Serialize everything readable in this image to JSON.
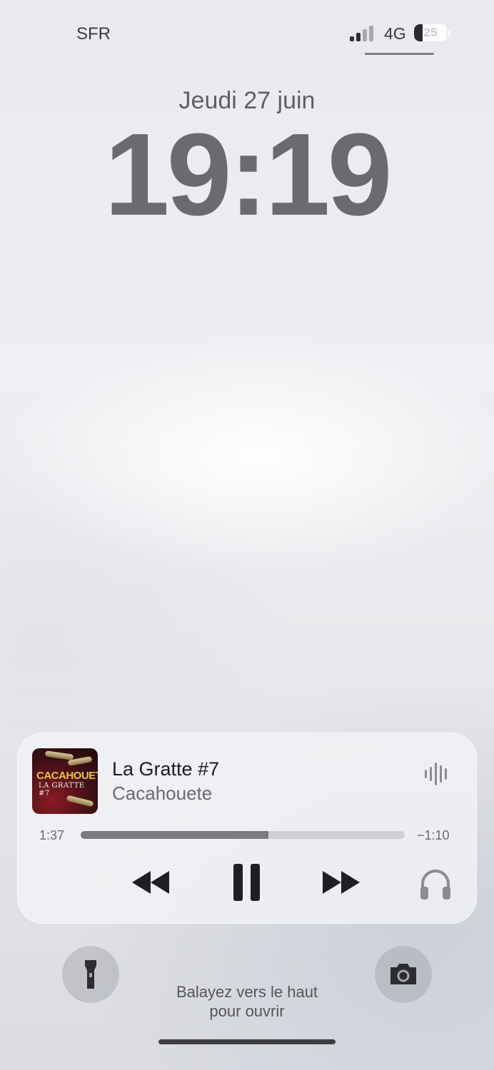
{
  "status_bar": {
    "carrier": "SFR",
    "network": "4G",
    "battery_percent": "25",
    "battery_level": 0.25,
    "signal_bars_active": 2,
    "signal_bars_total": 4
  },
  "lock": {
    "date": "Jeudi 27 juin",
    "time": "19:19"
  },
  "now_playing": {
    "title": "La Gratte #7",
    "artist": "Cacahouete",
    "artwork_text_main": "CACAHOUETE",
    "artwork_text_sub": "LA GRATTE #7",
    "elapsed": "1:37",
    "remaining": "−1:10",
    "progress_fraction": 0.58,
    "icons": {
      "waveform": "waveform-icon",
      "rewind": "rewind-icon",
      "pause": "pause-icon",
      "forward": "fast-forward-icon",
      "audio_output": "headphones-icon"
    }
  },
  "quick_actions": {
    "flashlight_icon": "flashlight-icon",
    "camera_icon": "camera-icon"
  },
  "swipe_hint": {
    "line1": "Balayez vers le haut",
    "line2": "pour ouvrir"
  }
}
